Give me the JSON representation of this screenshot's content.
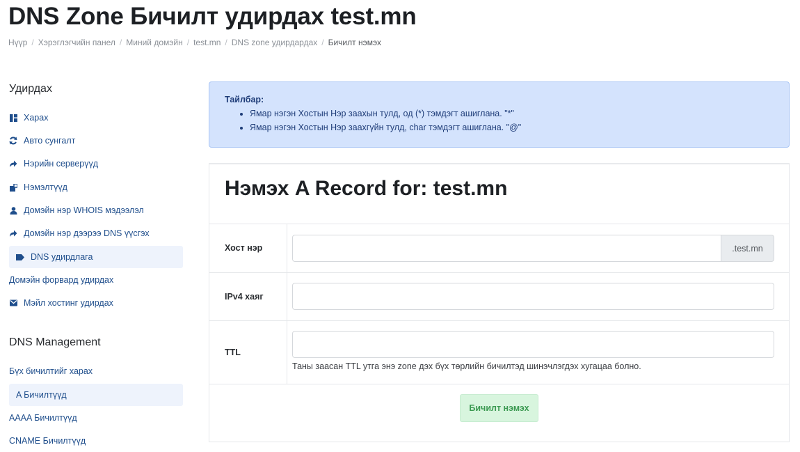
{
  "page": {
    "title": "DNS Zone Бичилт удирдах test.mn"
  },
  "breadcrumb": [
    "Нүүр",
    "Хэрэглэгчийн панел",
    "Миний домэйн",
    "test.mn",
    "DNS zone удирдардах",
    "Бичилт нэмэх"
  ],
  "sidebar": {
    "manage_heading": "Удирдах",
    "manage_items": [
      {
        "label": "Харах",
        "icon": "dashboard-icon"
      },
      {
        "label": "Авто сунгалт",
        "icon": "refresh-icon"
      },
      {
        "label": "Нэрийн серверүүд",
        "icon": "share-arrow-icon"
      },
      {
        "label": "Нэмэлтүүд",
        "icon": "addons-icon"
      },
      {
        "label": "Домэйн нэр WHOIS мэдээлэл",
        "icon": "user-icon"
      },
      {
        "label": "Домэйн нэр дээрээ DNS үүсгэх",
        "icon": "share-arrow-icon"
      },
      {
        "label": "DNS удирдлага",
        "icon": "tag-icon"
      },
      {
        "label": "Домэйн форвард удирдах",
        "icon": ""
      },
      {
        "label": "Мэйл хостинг удирдах",
        "icon": "mail-icon"
      }
    ],
    "dns_heading": "DNS Management",
    "dns_items": [
      {
        "label": "Бүх бичилтийг харах"
      },
      {
        "label": "A Бичилтүүд"
      },
      {
        "label": "AAAA Бичилтүүд"
      },
      {
        "label": "CNAME Бичилтүүд"
      }
    ]
  },
  "alert": {
    "title": "Тайлбар:",
    "items": [
      "Ямар нэгэн Хостын Нэр заахын тулд, од (*) тэмдэгт ашиглана. \"*\"",
      "Ямар нэгэн Хостын Нэр заахгүйн тулд, char тэмдэгт ашиглана. \"@\""
    ]
  },
  "form": {
    "title": "Нэмэх A Record for: test.mn",
    "host_label": "Хост нэр",
    "host_value": "",
    "host_suffix": ".test.mn",
    "ipv4_label": "IPv4 хаяг",
    "ipv4_value": "",
    "ttl_label": "TTL",
    "ttl_value": "",
    "ttl_help": "Таны заасан TTL утга энэ zone дэх бүх төрлийн бичилтэд шинэчлэгдэх хугацаа болно.",
    "submit_label": "Бичилт нэмэх"
  },
  "colors": {
    "link": "#1f4e8c",
    "alert_bg": "#d4e3fd",
    "submit_bg": "#d8f5de",
    "submit_text": "#3c9a52"
  }
}
